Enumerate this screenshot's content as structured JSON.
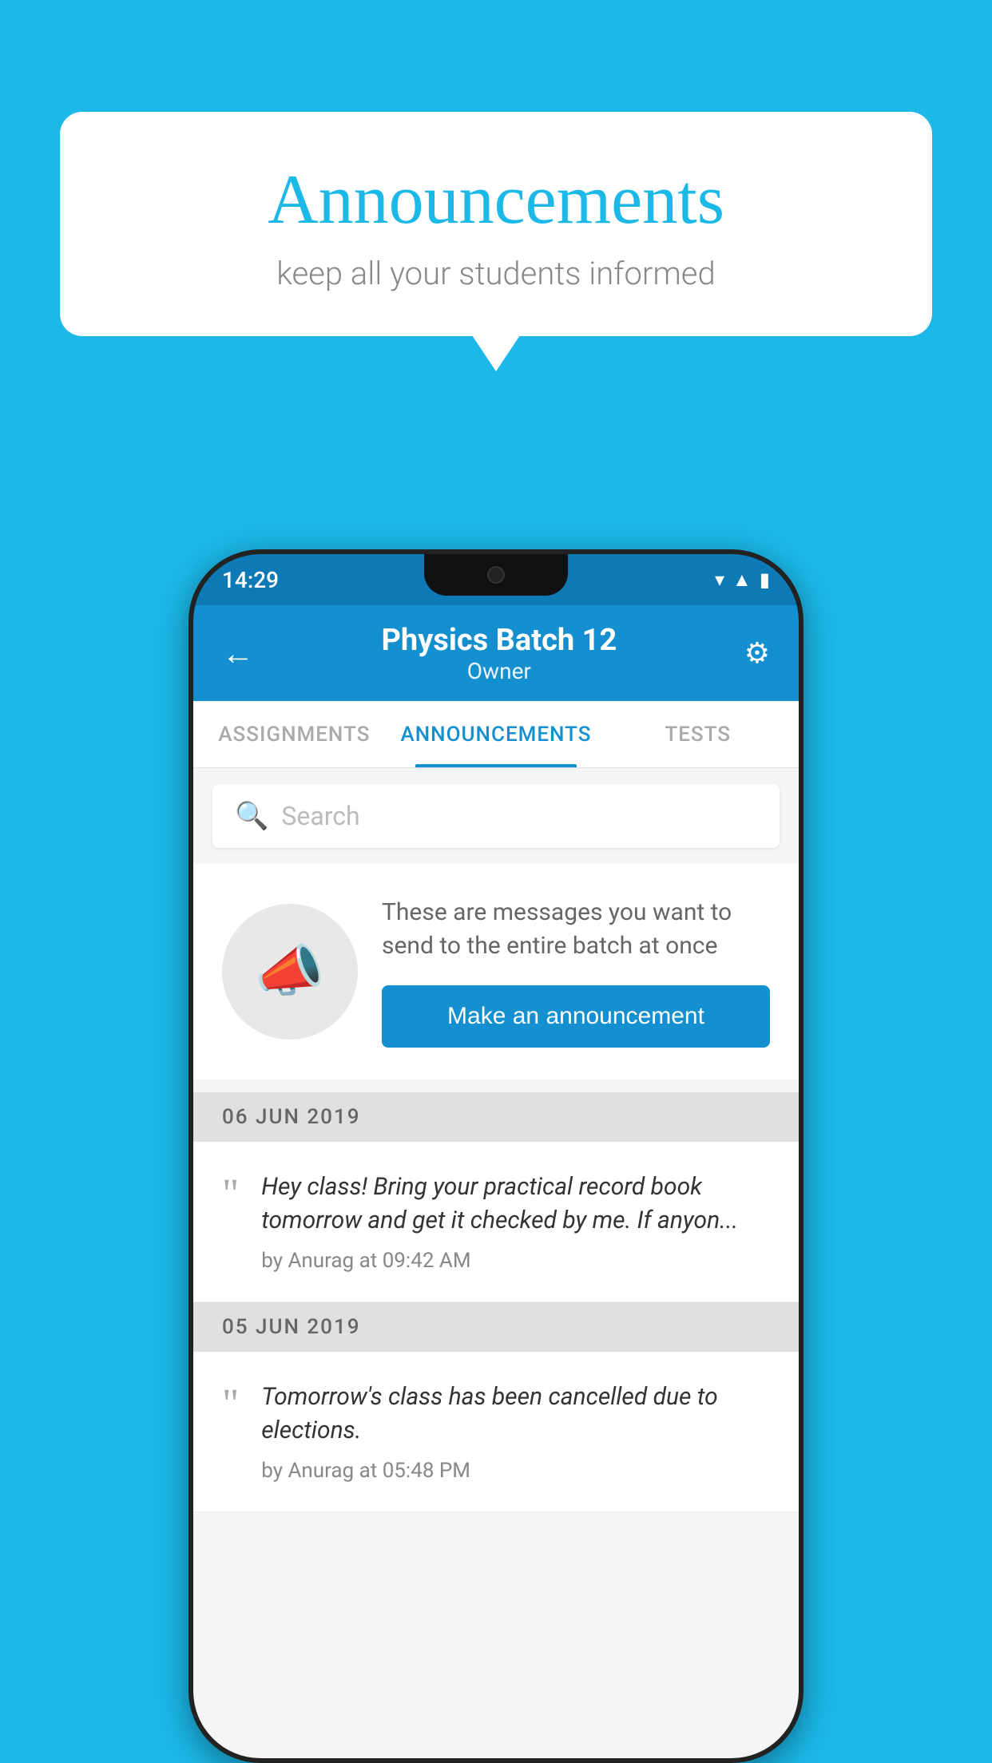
{
  "background_color": "#1bb8e8",
  "bubble": {
    "title": "Announcements",
    "subtitle": "keep all your students informed"
  },
  "phone": {
    "status_bar": {
      "time": "14:29"
    },
    "app_bar": {
      "title": "Physics Batch 12",
      "subtitle": "Owner",
      "back_label": "←",
      "settings_label": "⚙"
    },
    "tabs": [
      {
        "label": "ASSIGNMENTS",
        "active": false
      },
      {
        "label": "ANNOUNCEMENTS",
        "active": true
      },
      {
        "label": "TESTS",
        "active": false
      }
    ],
    "search": {
      "placeholder": "Search"
    },
    "promo": {
      "description": "These are messages you want to send to the entire batch at once",
      "button_label": "Make an announcement"
    },
    "announcements": [
      {
        "date": "06  JUN  2019",
        "text": "Hey class! Bring your practical record book tomorrow and get it checked by me. If anyon...",
        "meta": "by Anurag at 09:42 AM"
      },
      {
        "date": "05  JUN  2019",
        "text": "Tomorrow's class has been cancelled due to elections.",
        "meta": "by Anurag at 05:48 PM"
      }
    ]
  }
}
